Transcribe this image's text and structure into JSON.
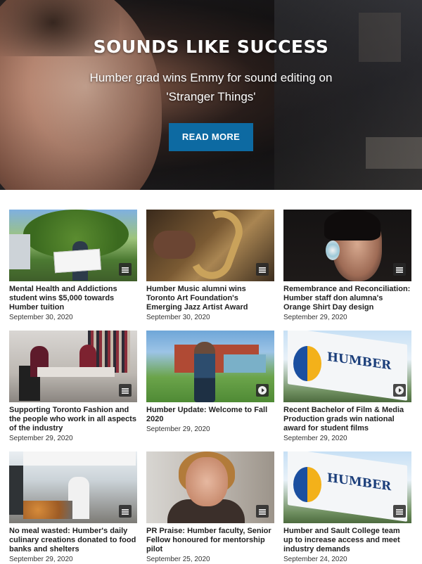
{
  "hero": {
    "title": "SOUNDS LIKE SUCCESS",
    "subtitle": "Humber grad wins Emmy for sound editing on 'Stranger Things'",
    "button_label": "READ MORE",
    "button_color": "#0d6aa2"
  },
  "articles": [
    {
      "title": "Mental Health and Addictions student wins $5,000 towards Humber tuition",
      "date": "September 30, 2020",
      "badge": "article-icon"
    },
    {
      "title": "Humber Music alumni wins Toronto Art Foundation's Emerging Jazz Artist Award",
      "date": "September 30, 2020",
      "badge": "article-icon"
    },
    {
      "title": "Remembrance and Reconciliation: Humber staff don alumna's Orange Shirt Day design",
      "date": "September 29, 2020",
      "badge": "article-icon"
    },
    {
      "title": "Supporting Toronto Fashion and the people who work in all aspects of the industry",
      "date": "September 29, 2020",
      "badge": "article-icon"
    },
    {
      "title": "Humber Update: Welcome to Fall 2020",
      "date": "September 29, 2020",
      "badge": "video-icon"
    },
    {
      "title": "Recent Bachelor of Film & Media Production grads win national award for student films",
      "date": "September 29, 2020",
      "badge": "video-icon"
    },
    {
      "title": "No meal wasted: Humber's daily culinary creations donated to food banks and shelters",
      "date": "September 29, 2020",
      "badge": "article-icon"
    },
    {
      "title": "PR Praise: Humber faculty, Senior Fellow honoured for mentorship pilot",
      "date": "September 25, 2020",
      "badge": "article-icon"
    },
    {
      "title": "Humber and Sault College team up to increase access and meet industry demands",
      "date": "September 24, 2020",
      "badge": "article-icon"
    }
  ],
  "thumb_sign_text": "HUMBER"
}
